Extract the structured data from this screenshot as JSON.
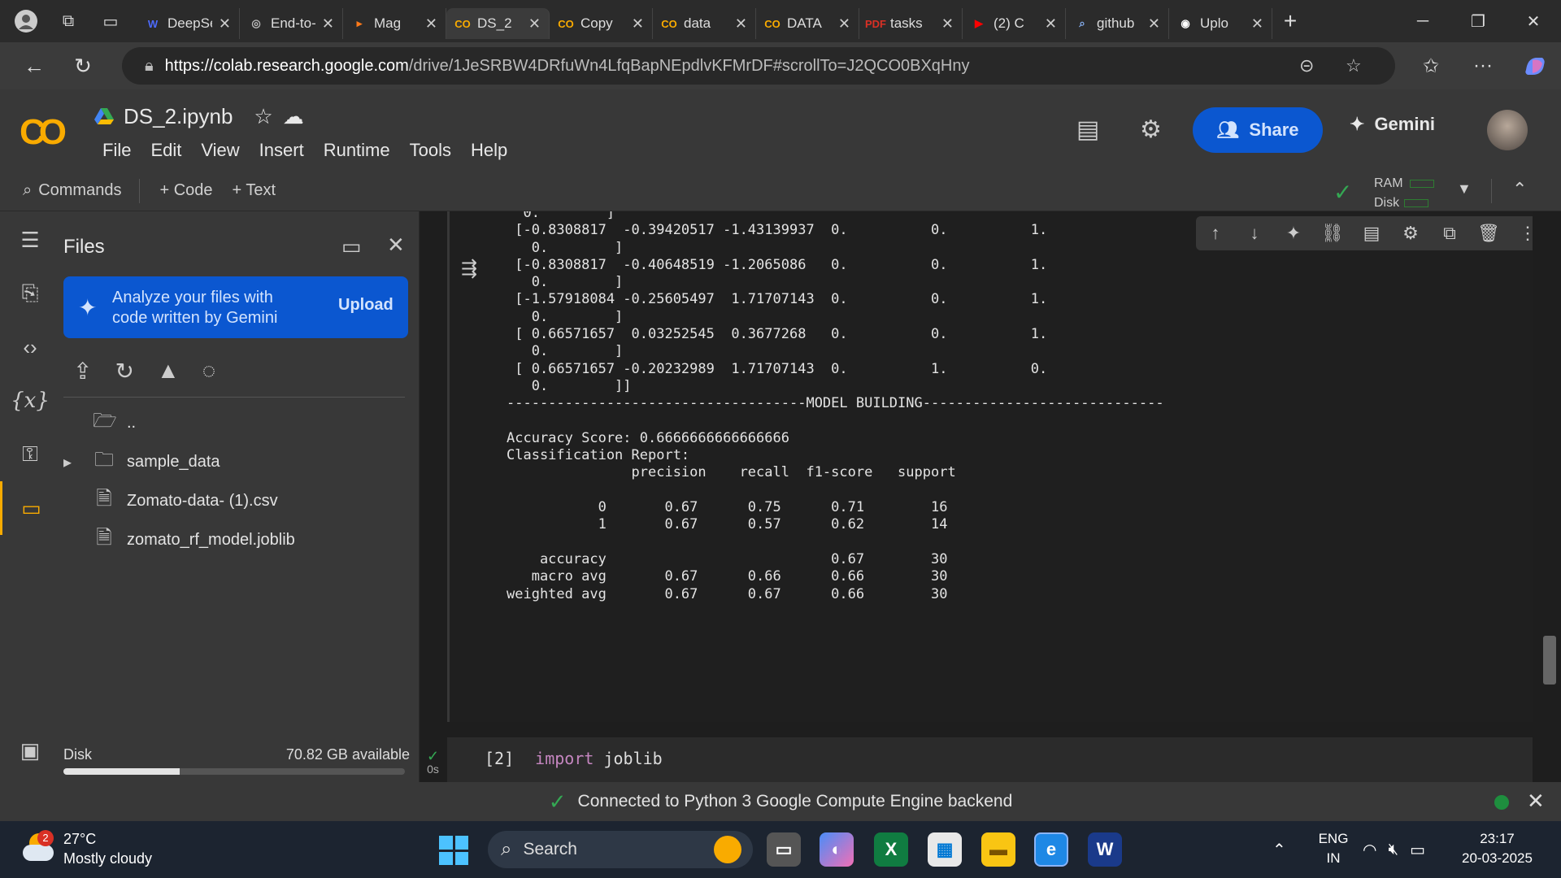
{
  "browser": {
    "tabs": [
      {
        "label": "DeepSeek",
        "fav": "W",
        "color": "#4d6bfe",
        "close": "✕"
      },
      {
        "label": "End-to-End",
        "fav": "◎",
        "color": "#bbbbbb",
        "close": "✕"
      },
      {
        "label": "Mag",
        "fav": "▸",
        "color": "#ff7a1a",
        "close": "✕"
      },
      {
        "label": "DS_2",
        "fav": "CO",
        "color": "#f9ab00",
        "close": "✕"
      },
      {
        "label": "Copy",
        "fav": "CO",
        "color": "#f9ab00",
        "close": "✕"
      },
      {
        "label": "data",
        "fav": "CO",
        "color": "#f9ab00",
        "close": "✕"
      },
      {
        "label": "DATA",
        "fav": "CO",
        "color": "#f9ab00",
        "close": "✕"
      },
      {
        "label": "tasks",
        "fav": "PDF",
        "color": "#d93025",
        "close": "✕"
      },
      {
        "label": "(2) C",
        "fav": "▶",
        "color": "#ff0000",
        "close": "✕"
      },
      {
        "label": "github",
        "fav": "⌕",
        "color": "#8ab4f8",
        "close": "✕"
      },
      {
        "label": "Uplo",
        "fav": "◉",
        "color": "#ffffff",
        "close": "✕"
      }
    ],
    "new_tab": "+",
    "url_host": "https://colab.research.google.com",
    "url_path": "/drive/1JeSRBW4DRfuWn4LfqBapNEpdlvKFMrDF#scrollTo=J2QCO0BXqHny"
  },
  "colab": {
    "logo": "CO",
    "notebook_title": "DS_2.ipynb",
    "menus": [
      "File",
      "Edit",
      "View",
      "Insert",
      "Runtime",
      "Tools",
      "Help"
    ],
    "share_label": "Share",
    "gemini_label": "Gemini",
    "toolbar": {
      "commands": "Commands",
      "code": "+ Code",
      "text": "+ Text",
      "ram": "RAM",
      "disk": "Disk"
    }
  },
  "files_panel": {
    "title": "Files",
    "gemini_prompt": "Analyze your files with code written by Gemini",
    "upload_label": "Upload",
    "tree": [
      {
        "name": "..",
        "kind": "folder-open",
        "arrow": ""
      },
      {
        "name": "sample_data",
        "kind": "folder",
        "arrow": "▸"
      },
      {
        "name": "Zomato-data- (1).csv",
        "kind": "file",
        "arrow": ""
      },
      {
        "name": "zomato_rf_model.joblib",
        "kind": "file",
        "arrow": ""
      }
    ],
    "disk_label": "Disk",
    "disk_available": "70.82 GB available",
    "disk_used_fraction": 0.34
  },
  "output_lines": [
    "  0.        ]",
    " [-0.8308817  -0.39420517 -1.43139937  0.          0.          1.",
    "   0.        ]",
    " [-0.8308817  -0.40648519 -1.2065086   0.          0.          1.",
    "   0.        ]",
    " [-1.57918084 -0.25605497  1.71707143  0.          0.          1.",
    "   0.        ]",
    " [ 0.66571657  0.03252545  0.3677268   0.          0.          1.",
    "   0.        ]",
    " [ 0.66571657 -0.20232989  1.71707143  0.          1.          0.",
    "   0.        ]]",
    "------------------------------------MODEL BUILDING-----------------------------",
    "",
    "Accuracy Score: 0.6666666666666666",
    "Classification Report:",
    "               precision    recall  f1-score   support",
    "",
    "           0       0.67      0.75      0.71        16",
    "           1       0.67      0.57      0.62        14",
    "",
    "    accuracy                           0.67        30",
    "   macro avg       0.67      0.66      0.66        30",
    "weighted avg       0.67      0.67      0.66        30"
  ],
  "next_cell": {
    "prompt": "[2]",
    "keyword": "import",
    "rest": " joblib",
    "exec_time": "0s"
  },
  "status": {
    "message": "Connected to Python 3 Google Compute Engine backend"
  },
  "taskbar": {
    "weather_temp": "27°C",
    "weather_desc": "Mostly cloudy",
    "weather_badge": "2",
    "search_placeholder": "Search",
    "lang_top": "ENG",
    "lang_bottom": "IN",
    "time": "23:17",
    "date": "20-03-2025"
  }
}
